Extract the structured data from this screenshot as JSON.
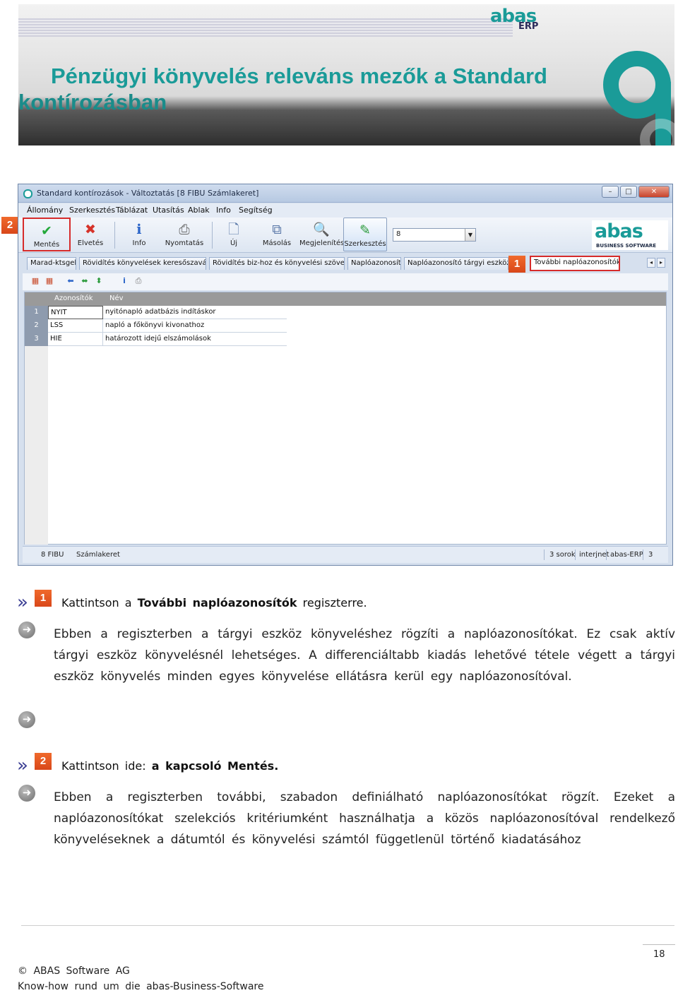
{
  "header": {
    "title_line1": "Pénzügyi könyvelés releváns mezők a Standard",
    "title_line2": "kontírozásban",
    "logo_top": "abas",
    "logo_bottom": "ERP"
  },
  "window": {
    "title": "Standard kontírozások - Változtatás  [8  FIBU  Számlakeret]",
    "controls": [
      "–",
      "□",
      "✕"
    ],
    "menu": [
      "Állomány",
      "Szerkesztés",
      "Táblázat",
      "Utasítás",
      "Ablak",
      "Info",
      "Segítség"
    ],
    "toolbar": [
      {
        "label": "Mentés",
        "icon": "checkmark-icon"
      },
      {
        "label": "Elvetés",
        "icon": "red-x-icon"
      },
      {
        "label": "Info",
        "icon": "info-icon"
      },
      {
        "label": "Nyomtatás",
        "icon": "printer-icon"
      },
      {
        "label": "Új",
        "icon": "new-document-icon"
      },
      {
        "label": "Másolás",
        "icon": "copy-icon"
      },
      {
        "label": "Megjelenítés",
        "icon": "magnifier-icon"
      },
      {
        "label": "Szerkesztés",
        "icon": "edit-icon"
      }
    ],
    "combo_value": "8",
    "logo_text": "abas",
    "logo_sub": "BUSINESS SOFTWARE",
    "tabs": [
      "Marad-ktsgek",
      "Rövidítés könyvelések keresőszavához",
      "Rövidítés biz-hoz és könyvelési szöveghez",
      "Naplóazonosító",
      "Naplóazonosító tárgyi eszköz kön",
      "További naplóazonosítók"
    ],
    "grid": {
      "columns": [
        "Azonosítók",
        "Név"
      ],
      "rows": [
        {
          "n": "1",
          "id": "NYIT",
          "name": "nyitónapló adatbázis indításkor"
        },
        {
          "n": "2",
          "id": "LSS",
          "name": "napló a főkönyvi kivonathoz"
        },
        {
          "n": "3",
          "id": "HIE",
          "name": "határozott idejű elszámolások"
        }
      ]
    },
    "status": {
      "left1": "8 FIBU",
      "left2": "Számlakeret",
      "rows": "3 sorok",
      "user": "interjnet",
      "app": "abas-ERP",
      "num": "3"
    }
  },
  "markers": {
    "one": "1",
    "two": "2"
  },
  "steps": [
    {
      "prefix": "Kattintson  a ",
      "bold": "További naplóazonosítók",
      "suffix": "  regiszterre.",
      "text": "Ebben a regiszterben a tárgyi eszköz könyveléshez rögzíti a naplóazonosítókat. Ez csak aktív tárgyi eszköz könyvelésnél lehetséges. A differenciáltabb kiadás lehetővé tétele végett a tárgyi eszköz könyvelés minden egyes könyvelése ellátásra kerül egy naplóazonosítóval."
    },
    {
      "prefix": "Kattintson  ide:  ",
      "bold": "a kapcsoló Mentés.",
      "suffix": "",
      "text": "Ebben a regiszterben további, szabadon definiálható naplóazonosítókat rögzít. Ezeket a naplóazonosítókat szelekciós kritériumként használhatja a közös naplóazonosítóval rendelkező könyveléseknek a dátumtól és könyvelési számtól függetlenül történő kiadatásához"
    }
  ],
  "footer": {
    "page_number": "18",
    "copyright": "©  ABAS  Software  AG",
    "tagline": "Know-how  rund  um  die  abas-Business-Software"
  }
}
